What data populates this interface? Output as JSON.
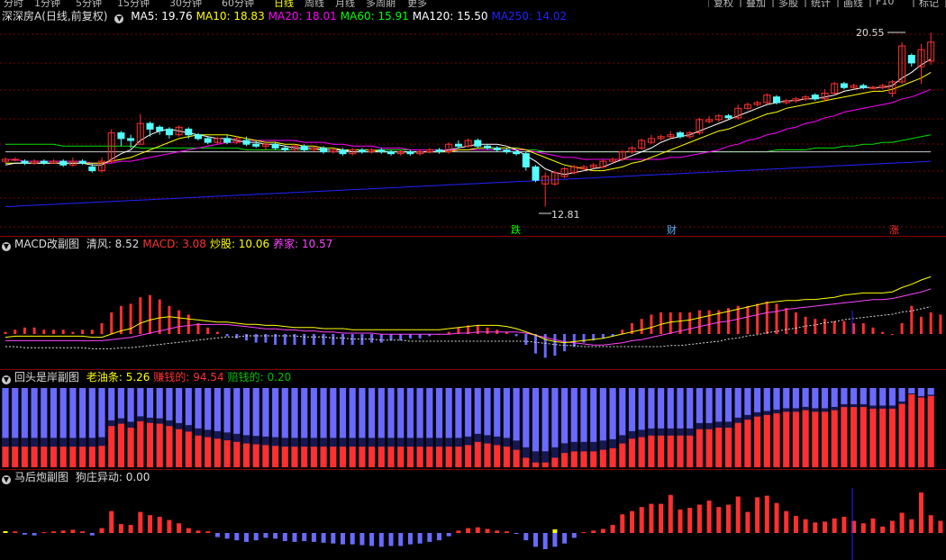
{
  "toolbar": {
    "left_items": [
      "分时",
      "1分钟",
      "5分钟",
      "15分钟",
      "30分钟",
      "60分钟",
      "日线",
      "周线",
      "月线",
      "多周期",
      "更多"
    ],
    "right_items": [
      "复权",
      "叠加",
      "多股",
      "统计",
      "画线",
      "F10",
      "标记"
    ]
  },
  "main_panel": {
    "stock_name": "深深房A",
    "period_label": "(日线,前复权)",
    "ma_labels": [
      {
        "text": "MA5: 19.76",
        "color": "#ffffff"
      },
      {
        "text": "MA10: 18.83",
        "color": "#ffff00"
      },
      {
        "text": "MA20: 18.01",
        "color": "#ff00ff"
      },
      {
        "text": "MA60: 15.91",
        "color": "#00ff00"
      },
      {
        "text": "MA120: 15.50",
        "color": "#ffffff"
      },
      {
        "text": "MA250: 14.02",
        "color": "#2222ff"
      }
    ],
    "high_label": "20.55",
    "low_label": "12.81",
    "signals": [
      {
        "text": "跌",
        "color": "#00ff00"
      },
      {
        "text": "财",
        "color": "#5ab4ff"
      },
      {
        "text": "涨",
        "color": "#ff3030"
      }
    ]
  },
  "macd_panel": {
    "title": "MACD改副图",
    "labels": [
      {
        "text": "清风: 8.52",
        "color": "#dddddd"
      },
      {
        "text": "MACD: 3.08",
        "color": "#ff3030"
      },
      {
        "text": "炒股: 10.06",
        "color": "#ffff00"
      },
      {
        "text": "养家: 10.57",
        "color": "#ff44ff"
      }
    ]
  },
  "huitou_panel": {
    "title": "回头是岸副图",
    "labels": [
      {
        "text": "老油条: 5.26",
        "color": "#ffff00"
      },
      {
        "text": "赚钱的: 94.54",
        "color": "#ff3030"
      },
      {
        "text": "赔钱的: 0.20",
        "color": "#00c000"
      }
    ]
  },
  "mahou_panel": {
    "title": "马后炮副图",
    "labels": [
      {
        "text": "狗庄异动: 0.00",
        "color": "#dddddd"
      }
    ]
  },
  "colors": {
    "up": "#ff3030",
    "down": "#54ffff",
    "grid": "#7a0000",
    "border": "#8a0000",
    "blue_bar": "#6a6aff",
    "dark_blue": "#161650"
  },
  "chart_data": {
    "type": "candlestick",
    "candles": [
      [
        15.4,
        15.5,
        15.6,
        15.3
      ],
      [
        15.5,
        15.5,
        15.6,
        15.4
      ],
      [
        15.4,
        15.3,
        15.5,
        15.2
      ],
      [
        15.3,
        15.4,
        15.5,
        15.2
      ],
      [
        15.4,
        15.3,
        15.5,
        15.2
      ],
      [
        15.3,
        15.4,
        15.5,
        15.3
      ],
      [
        15.4,
        15.2,
        15.5,
        15.1
      ],
      [
        15.2,
        15.4,
        15.6,
        15.1
      ],
      [
        15.4,
        15.3,
        15.5,
        15.2
      ],
      [
        15.1,
        14.9,
        15.3,
        14.8
      ],
      [
        14.9,
        15.4,
        15.6,
        14.8
      ],
      [
        15.4,
        16.9,
        17.1,
        15.3
      ],
      [
        16.9,
        16.6,
        17.0,
        16.2
      ],
      [
        16.6,
        16.5,
        16.8,
        16.1
      ],
      [
        16.3,
        17.4,
        17.9,
        16.3
      ],
      [
        17.4,
        17.1,
        17.5,
        16.7
      ],
      [
        17.2,
        17.0,
        17.3,
        16.8
      ],
      [
        17.1,
        16.8,
        17.2,
        16.6
      ],
      [
        16.8,
        17.2,
        17.3,
        16.7
      ],
      [
        17.1,
        16.8,
        17.2,
        16.6
      ],
      [
        16.8,
        16.6,
        16.9,
        16.5
      ],
      [
        16.6,
        16.4,
        16.7,
        16.3
      ],
      [
        16.4,
        16.6,
        16.7,
        16.3
      ],
      [
        16.6,
        16.4,
        16.8,
        16.3
      ],
      [
        16.4,
        16.6,
        16.7,
        16.3
      ],
      [
        16.5,
        16.3,
        16.7,
        16.2
      ],
      [
        16.3,
        16.2,
        16.5,
        16.1
      ],
      [
        16.2,
        16.3,
        16.4,
        16.0
      ],
      [
        16.3,
        16.1,
        16.4,
        16.0
      ],
      [
        16.1,
        16.0,
        16.2,
        15.9
      ],
      [
        16.0,
        16.2,
        16.3,
        15.9
      ],
      [
        16.2,
        16.0,
        16.3,
        15.9
      ],
      [
        16.0,
        16.1,
        16.2,
        15.9
      ],
      [
        16.1,
        15.9,
        16.2,
        15.8
      ],
      [
        15.9,
        16.0,
        16.1,
        15.8
      ],
      [
        16.0,
        15.8,
        16.1,
        15.7
      ],
      [
        15.8,
        16.0,
        16.1,
        15.7
      ],
      [
        16.0,
        15.9,
        16.1,
        15.8
      ],
      [
        15.9,
        16.0,
        16.1,
        15.8
      ],
      [
        16.0,
        15.9,
        16.1,
        15.8
      ],
      [
        15.9,
        15.8,
        16.0,
        15.7
      ],
      [
        15.8,
        15.9,
        16.0,
        15.7
      ],
      [
        15.9,
        15.8,
        16.0,
        15.7
      ],
      [
        15.8,
        15.9,
        16.0,
        15.7
      ],
      [
        15.9,
        16.0,
        16.1,
        15.8
      ],
      [
        16.0,
        15.9,
        16.1,
        15.8
      ],
      [
        15.9,
        16.3,
        16.4,
        15.8
      ],
      [
        16.3,
        16.2,
        16.5,
        16.1
      ],
      [
        16.2,
        16.5,
        16.6,
        16.1
      ],
      [
        16.5,
        16.2,
        16.6,
        16.1
      ],
      [
        16.2,
        16.1,
        16.3,
        16.0
      ],
      [
        16.1,
        16.0,
        16.2,
        15.9
      ],
      [
        16.0,
        15.9,
        16.1,
        15.8
      ],
      [
        15.9,
        15.8,
        16.0,
        15.7
      ],
      [
        15.8,
        15.1,
        15.9,
        14.9
      ],
      [
        15.1,
        14.4,
        15.2,
        14.3
      ],
      [
        14.2,
        14.6,
        14.8,
        13.0
      ],
      [
        14.2,
        14.8,
        14.9,
        14.1
      ],
      [
        14.6,
        15.0,
        15.1,
        14.5
      ],
      [
        14.8,
        15.1,
        15.2,
        14.7
      ],
      [
        15.0,
        15.1,
        15.2,
        14.9
      ],
      [
        15.1,
        15.2,
        15.3,
        15.0
      ],
      [
        15.1,
        15.4,
        15.5,
        15.0
      ],
      [
        15.4,
        15.5,
        15.6,
        15.3
      ],
      [
        15.5,
        15.9,
        16.0,
        15.4
      ],
      [
        15.9,
        16.1,
        16.2,
        15.8
      ],
      [
        16.1,
        16.5,
        16.6,
        16.0
      ],
      [
        16.4,
        16.6,
        16.8,
        16.3
      ],
      [
        16.6,
        16.7,
        16.8,
        16.5
      ],
      [
        16.7,
        16.8,
        17.0,
        16.6
      ],
      [
        16.9,
        16.7,
        17.0,
        16.6
      ],
      [
        16.7,
        16.9,
        17.0,
        16.6
      ],
      [
        16.9,
        17.6,
        17.7,
        16.8
      ],
      [
        17.5,
        17.6,
        17.8,
        17.4
      ],
      [
        17.6,
        17.8,
        17.9,
        17.5
      ],
      [
        17.8,
        17.7,
        17.9,
        17.6
      ],
      [
        17.7,
        18.2,
        18.4,
        17.6
      ],
      [
        18.2,
        18.4,
        18.5,
        18.1
      ],
      [
        18.4,
        18.5,
        18.6,
        18.3
      ],
      [
        18.5,
        18.9,
        19.0,
        18.4
      ],
      [
        18.8,
        18.5,
        18.9,
        18.4
      ],
      [
        18.5,
        18.6,
        18.7,
        18.4
      ],
      [
        18.6,
        18.7,
        18.8,
        18.5
      ],
      [
        18.7,
        18.8,
        18.9,
        18.6
      ],
      [
        18.9,
        18.7,
        19.0,
        18.6
      ],
      [
        18.7,
        19.0,
        19.2,
        18.6
      ],
      [
        19.0,
        19.5,
        19.6,
        18.9
      ],
      [
        19.5,
        19.3,
        19.6,
        19.2
      ],
      [
        19.3,
        19.4,
        19.5,
        19.2
      ],
      [
        19.4,
        19.3,
        19.5,
        19.2
      ],
      [
        19.3,
        19.3,
        19.4,
        19.2
      ],
      [
        19.3,
        19.4,
        19.5,
        19.2
      ],
      [
        19.0,
        19.6,
        19.7,
        18.8
      ],
      [
        19.6,
        21.5,
        21.7,
        19.5
      ],
      [
        21.0,
        20.6,
        21.1,
        20.4
      ],
      [
        20.4,
        21.3,
        21.6,
        19.5
      ],
      [
        20.7,
        21.7,
        22.2,
        20.5
      ]
    ],
    "ma5": [
      15.2,
      15.3,
      15.3,
      15.3,
      15.3,
      15.3,
      15.3,
      15.3,
      15.3,
      15.2,
      15.2,
      15.5,
      15.8,
      16.0,
      16.5,
      16.8,
      17.0,
      17.1,
      17.0,
      16.9,
      16.8,
      16.7,
      16.6,
      16.6,
      16.5,
      16.4,
      16.4,
      16.3,
      16.3,
      16.2,
      16.1,
      16.1,
      16.1,
      16.0,
      16.0,
      16.0,
      15.9,
      15.9,
      15.9,
      15.9,
      15.9,
      15.9,
      15.9,
      15.9,
      15.9,
      15.9,
      16.0,
      16.1,
      16.2,
      16.3,
      16.3,
      16.3,
      16.2,
      16.0,
      15.7,
      15.4,
      15.0,
      14.8,
      14.7,
      14.8,
      14.9,
      15.0,
      15.1,
      15.3,
      15.5,
      15.7,
      15.9,
      16.1,
      16.4,
      16.6,
      16.7,
      16.8,
      17.0,
      17.2,
      17.4,
      17.6,
      17.8,
      18.0,
      18.2,
      18.4,
      18.5,
      18.6,
      18.6,
      18.7,
      18.7,
      18.8,
      18.9,
      19.1,
      19.2,
      19.3,
      19.3,
      19.3,
      19.4,
      19.8,
      20.1,
      20.5,
      20.8
    ],
    "ma10": [
      15.3,
      15.3,
      15.3,
      15.3,
      15.3,
      15.3,
      15.3,
      15.3,
      15.3,
      15.3,
      15.3,
      15.4,
      15.5,
      15.6,
      15.8,
      16.0,
      16.2,
      16.4,
      16.6,
      16.7,
      16.8,
      16.8,
      16.8,
      16.8,
      16.7,
      16.6,
      16.5,
      16.4,
      16.4,
      16.3,
      16.3,
      16.2,
      16.2,
      16.1,
      16.1,
      16.0,
      16.0,
      16.0,
      16.0,
      15.9,
      15.9,
      15.9,
      15.9,
      15.9,
      15.9,
      15.9,
      15.9,
      16.0,
      16.0,
      16.1,
      16.1,
      16.1,
      16.1,
      16.1,
      16.0,
      15.8,
      15.6,
      15.4,
      15.2,
      15.1,
      15.0,
      14.9,
      14.9,
      15.0,
      15.1,
      15.3,
      15.4,
      15.6,
      15.8,
      16.0,
      16.2,
      16.4,
      16.6,
      16.8,
      17.0,
      17.1,
      17.3,
      17.5,
      17.7,
      17.9,
      18.0,
      18.2,
      18.3,
      18.4,
      18.5,
      18.6,
      18.7,
      18.8,
      18.9,
      19.0,
      19.1,
      19.1,
      19.2,
      19.4,
      19.6,
      19.8,
      20.1
    ],
    "ma20": [
      15.5,
      15.5,
      15.4,
      15.4,
      15.4,
      15.4,
      15.4,
      15.4,
      15.4,
      15.3,
      15.3,
      15.3,
      15.4,
      15.4,
      15.5,
      15.6,
      15.7,
      15.8,
      15.9,
      16.0,
      16.1,
      16.2,
      16.3,
      16.4,
      16.4,
      16.5,
      16.5,
      16.5,
      16.5,
      16.5,
      16.5,
      16.4,
      16.4,
      16.4,
      16.3,
      16.3,
      16.2,
      16.2,
      16.2,
      16.1,
      16.1,
      16.1,
      16.0,
      16.0,
      16.0,
      16.0,
      16.0,
      16.0,
      16.0,
      16.0,
      16.0,
      16.0,
      16.0,
      16.0,
      16.0,
      15.9,
      15.8,
      15.7,
      15.6,
      15.6,
      15.5,
      15.5,
      15.5,
      15.5,
      15.5,
      15.5,
      15.5,
      15.5,
      15.5,
      15.6,
      15.6,
      15.7,
      15.8,
      15.9,
      16.0,
      16.2,
      16.3,
      16.5,
      16.6,
      16.8,
      16.9,
      17.1,
      17.2,
      17.4,
      17.5,
      17.7,
      17.8,
      18.0,
      18.1,
      18.2,
      18.3,
      18.4,
      18.5,
      18.7,
      18.8,
      19.0,
      19.2
    ],
    "ma60": [
      16.3,
      16.3,
      16.3,
      16.3,
      16.3,
      16.3,
      16.2,
      16.2,
      16.2,
      16.2,
      16.2,
      16.2,
      16.2,
      16.2,
      16.1,
      16.1,
      16.1,
      16.1,
      16.1,
      16.1,
      16.1,
      16.1,
      16.1,
      16.1,
      16.1,
      16.0,
      16.0,
      16.0,
      16.0,
      16.0,
      16.0,
      16.0,
      16.0,
      16.0,
      16.0,
      16.0,
      16.0,
      16.0,
      16.0,
      16.0,
      16.0,
      16.0,
      16.0,
      16.0,
      16.0,
      16.0,
      16.0,
      16.0,
      16.0,
      16.0,
      16.0,
      16.0,
      16.0,
      16.0,
      16.0,
      16.0,
      15.9,
      15.9,
      15.9,
      15.9,
      15.9,
      15.9,
      15.9,
      15.9,
      15.9,
      15.9,
      15.9,
      15.9,
      15.9,
      15.9,
      15.9,
      15.9,
      15.9,
      15.9,
      15.9,
      15.9,
      15.9,
      15.9,
      15.9,
      15.9,
      16.0,
      16.0,
      16.0,
      16.0,
      16.1,
      16.1,
      16.1,
      16.2,
      16.2,
      16.3,
      16.3,
      16.4,
      16.4,
      16.5,
      16.6,
      16.7,
      16.8
    ],
    "ma120": [
      15.9,
      15.9,
      15.9,
      15.9,
      15.9,
      15.9,
      15.9,
      15.9,
      15.9,
      15.9,
      15.9,
      15.9,
      15.9,
      15.9,
      15.9,
      15.9,
      15.9,
      15.9,
      15.9,
      15.9,
      15.9,
      15.9,
      15.9,
      15.9,
      15.9,
      15.9,
      15.9,
      15.9,
      15.9,
      15.9,
      15.9,
      15.9,
      15.9,
      15.9,
      15.9,
      15.9,
      15.9,
      15.9,
      15.9,
      15.9,
      15.9,
      15.9,
      15.9,
      15.9,
      15.9,
      15.9,
      15.9,
      15.9,
      15.9,
      15.9,
      15.9,
      15.9,
      15.9,
      15.9,
      15.9,
      15.9,
      15.9,
      15.9,
      15.9,
      15.9,
      15.9,
      15.9,
      15.9,
      15.9,
      15.9,
      15.9,
      15.9,
      15.9,
      15.9,
      15.9,
      15.9,
      15.9,
      15.9,
      15.9,
      15.9,
      15.9,
      15.9,
      15.9,
      15.9,
      15.9,
      15.9,
      15.9,
      15.9,
      15.9,
      15.9,
      15.9,
      15.9,
      15.9,
      15.9,
      15.9,
      15.9,
      15.9,
      15.9,
      15.9,
      15.9,
      15.9,
      15.9
    ],
    "ma250": [
      13.0,
      13.02,
      13.05,
      13.07,
      13.1,
      13.12,
      13.15,
      13.17,
      13.2,
      13.22,
      13.25,
      13.27,
      13.3,
      13.32,
      13.35,
      13.37,
      13.4,
      13.42,
      13.45,
      13.47,
      13.5,
      13.52,
      13.55,
      13.57,
      13.6,
      13.62,
      13.65,
      13.67,
      13.7,
      13.72,
      13.75,
      13.77,
      13.8,
      13.82,
      13.85,
      13.87,
      13.9,
      13.92,
      13.95,
      13.97,
      14.0,
      14.02,
      14.05,
      14.07,
      14.1,
      14.12,
      14.15,
      14.17,
      14.2,
      14.22,
      14.25,
      14.27,
      14.3,
      14.32,
      14.35,
      14.37,
      14.4,
      14.42,
      14.45,
      14.47,
      14.5,
      14.52,
      14.55,
      14.57,
      14.6,
      14.62,
      14.65,
      14.67,
      14.7,
      14.72,
      14.75,
      14.77,
      14.8,
      14.82,
      14.85,
      14.87,
      14.9,
      14.92,
      14.95,
      14.97,
      15.0,
      15.02,
      15.05,
      15.07,
      15.1,
      15.12,
      15.15,
      15.17,
      15.2,
      15.22,
      15.25,
      15.27,
      15.3,
      15.32,
      15.35,
      15.37,
      15.4
    ],
    "macd_hist": [
      0.1,
      0.2,
      0.3,
      0.3,
      0.2,
      0.2,
      0.2,
      0.1,
      0.2,
      0.2,
      0.5,
      1.0,
      1.3,
      1.4,
      1.7,
      1.8,
      1.6,
      1.3,
      1.1,
      0.9,
      0.5,
      0.3,
      0.1,
      -0.1,
      -0.2,
      -0.3,
      -0.4,
      -0.4,
      -0.5,
      -0.5,
      -0.5,
      -0.5,
      -0.5,
      -0.5,
      -0.5,
      -0.5,
      -0.5,
      -0.5,
      -0.4,
      -0.4,
      -0.3,
      -0.3,
      -0.2,
      -0.2,
      -0.1,
      0.0,
      0.1,
      0.3,
      0.4,
      0.4,
      0.3,
      0.2,
      0.1,
      -0.1,
      -0.5,
      -0.9,
      -1.1,
      -1.0,
      -0.8,
      -0.6,
      -0.4,
      -0.3,
      -0.2,
      -0.1,
      0.2,
      0.5,
      0.7,
      0.9,
      1.0,
      1.0,
      1.0,
      1.0,
      1.1,
      1.1,
      1.1,
      1.2,
      1.3,
      1.3,
      1.4,
      1.5,
      1.4,
      1.2,
      1.0,
      0.8,
      0.7,
      0.7,
      0.6,
      0.6,
      0.5,
      0.5,
      0.3,
      0.1,
      0.0,
      0.5,
      1.3,
      0.8,
      1.0,
      0.9,
      1.0,
      1.0,
      1.1
    ],
    "huitou_red": [
      0.26,
      0.26,
      0.26,
      0.26,
      0.26,
      0.26,
      0.26,
      0.26,
      0.26,
      0.26,
      0.27,
      0.52,
      0.55,
      0.5,
      0.58,
      0.56,
      0.55,
      0.52,
      0.48,
      0.45,
      0.4,
      0.38,
      0.36,
      0.34,
      0.32,
      0.3,
      0.29,
      0.28,
      0.27,
      0.26,
      0.26,
      0.26,
      0.26,
      0.26,
      0.26,
      0.26,
      0.26,
      0.26,
      0.26,
      0.26,
      0.26,
      0.26,
      0.26,
      0.26,
      0.26,
      0.26,
      0.26,
      0.26,
      0.28,
      0.32,
      0.3,
      0.28,
      0.26,
      0.22,
      0.12,
      0.06,
      0.06,
      0.12,
      0.18,
      0.2,
      0.2,
      0.2,
      0.22,
      0.24,
      0.3,
      0.36,
      0.38,
      0.4,
      0.4,
      0.4,
      0.4,
      0.4,
      0.48,
      0.48,
      0.5,
      0.5,
      0.56,
      0.6,
      0.64,
      0.66,
      0.68,
      0.7,
      0.7,
      0.72,
      0.7,
      0.7,
      0.72,
      0.76,
      0.76,
      0.76,
      0.74,
      0.74,
      0.74,
      0.8,
      0.92,
      0.88,
      0.9
    ],
    "mahou": [
      0.2,
      0.2,
      -0.2,
      -0.3,
      0.1,
      0.2,
      0.3,
      0.4,
      0.2,
      -0.3,
      0.6,
      2.7,
      1.1,
      1.0,
      2.6,
      2.2,
      2.0,
      1.6,
      1.2,
      0.6,
      0.3,
      0.2,
      -0.5,
      -0.7,
      -0.9,
      -1.1,
      -0.9,
      -0.6,
      -0.7,
      -1.0,
      -1.1,
      -1.0,
      -1.1,
      -1.2,
      -1.3,
      -1.4,
      -1.4,
      -1.5,
      -1.6,
      -1.7,
      -1.6,
      -1.6,
      -1.4,
      -1.3,
      -1.1,
      -0.9,
      -0.4,
      0.3,
      0.6,
      0.7,
      0.5,
      0.3,
      0.2,
      -0.1,
      -0.9,
      -1.7,
      -2.0,
      -1.7,
      -1.3,
      -0.6,
      0.1,
      0.3,
      0.5,
      1.0,
      2.3,
      2.7,
      3.2,
      3.6,
      3.6,
      4.7,
      2.9,
      3.1,
      3.5,
      4.0,
      3.2,
      3.5,
      4.5,
      2.6,
      4.4,
      4.6,
      3.7,
      2.7,
      2.1,
      1.7,
      1.3,
      1.4,
      1.8,
      2.0,
      1.5,
      1.2,
      1.8,
      0.8,
      1.5,
      2.5,
      1.7,
      5.0,
      2.2,
      1.5,
      3.1,
      2.1
    ]
  }
}
